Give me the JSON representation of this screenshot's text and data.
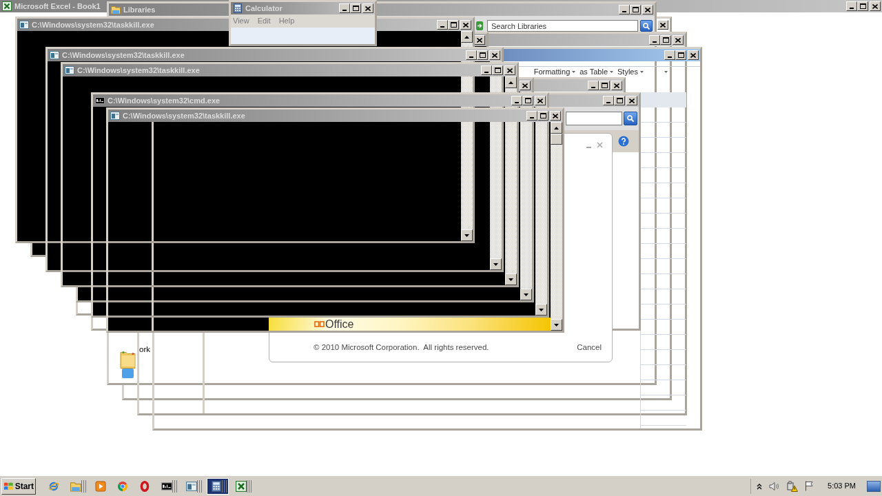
{
  "windows": [
    {
      "kind": "app",
      "title": "Microsoft Excel - Book1",
      "active": false,
      "controls": [
        {
          "kind": "minimize"
        },
        {
          "kind": "maximize"
        },
        {
          "kind": "close"
        }
      ]
    },
    {
      "kind": "explorer",
      "controls": [
        {
          "kind": "close"
        }
      ]
    },
    {
      "kind": "explorer",
      "title": "Libraries",
      "active": false,
      "controls": [
        {
          "kind": "minimize"
        },
        {
          "kind": "maximize"
        },
        {
          "kind": "close"
        }
      ],
      "search_box": true,
      "search_placeholder": "Search Libraries",
      "nav_items": [
        {
          "label": "ork"
        }
      ]
    },
    {
      "kind": "explorer",
      "active": false,
      "controls": [
        {
          "kind": "minimize"
        },
        {
          "kind": "maximize"
        },
        {
          "kind": "close"
        }
      ]
    },
    {
      "kind": "spreadsheet",
      "active": true,
      "controls": [
        {
          "kind": "minimize"
        },
        {
          "kind": "maximize"
        },
        {
          "kind": "close"
        }
      ],
      "ribbon": [
        {
          "kind": "dropdown",
          "label": "Formatting"
        },
        {
          "kind": "dropdown",
          "label": "as Table"
        },
        {
          "kind": "dropdown",
          "label": "Styles"
        },
        {
          "kind": "caret"
        }
      ]
    },
    {
      "kind": "explorer",
      "active": false,
      "controls": [
        {
          "kind": "minimize"
        },
        {
          "kind": "maximize"
        },
        {
          "kind": "close"
        }
      ]
    },
    {
      "kind": "explorer",
      "active": false,
      "controls": [
        {
          "kind": "minimize"
        },
        {
          "kind": "maximize"
        },
        {
          "kind": "close"
        }
      ],
      "search_box": true,
      "help_button": true
    },
    {
      "kind": "splash",
      "controls": [
        {
          "kind": "minimize"
        },
        {
          "kind": "close"
        }
      ],
      "logo_text": "Office",
      "copyright": "© 2010 Microsoft Corporation.  All rights reserved.",
      "cancel": "Cancel"
    },
    {
      "kind": "console",
      "controls": [
        {
          "kind": "close"
        }
      ]
    },
    {
      "kind": "console",
      "title": "C:\\Windows\\system32\\taskkill.exe",
      "active": false,
      "controls": [
        {
          "kind": "minimize"
        },
        {
          "kind": "maximize"
        },
        {
          "kind": "close"
        }
      ]
    },
    {
      "kind": "console",
      "title": "C:\\Windows\\system32\\taskkill.exe",
      "active": false,
      "controls": [
        {
          "kind": "minimize"
        },
        {
          "kind": "maximize"
        },
        {
          "kind": "close"
        }
      ]
    },
    {
      "kind": "console",
      "controls": [
        {
          "kind": "close"
        }
      ]
    },
    {
      "kind": "console",
      "title": "C:\\Windows\\system32\\taskkill.exe",
      "active": false,
      "controls": [
        {
          "kind": "minimize"
        },
        {
          "kind": "maximize"
        },
        {
          "kind": "close"
        }
      ]
    },
    {
      "kind": "console",
      "title": "C:\\Windows\\system32\\cmd.exe",
      "active": false,
      "controls": [
        {
          "kind": "minimize"
        },
        {
          "kind": "maximize"
        },
        {
          "kind": "close"
        }
      ]
    },
    {
      "kind": "console",
      "title": "C:\\Windows\\system32\\taskkill.exe",
      "active": false,
      "controls": [
        {
          "kind": "minimize"
        },
        {
          "kind": "maximize"
        },
        {
          "kind": "close"
        }
      ]
    },
    {
      "kind": "calculator",
      "title": "Calculator",
      "active": false,
      "controls": [
        {
          "kind": "minimize"
        },
        {
          "kind": "maximize"
        },
        {
          "kind": "close"
        }
      ],
      "menu": [
        "View",
        "Edit",
        "Help"
      ]
    }
  ],
  "taskbar": {
    "start": "Start",
    "items": [
      {
        "open": false,
        "selected": false
      },
      {
        "open": true,
        "selected": false
      },
      {
        "open": false,
        "selected": false
      },
      {
        "open": false,
        "selected": false
      },
      {
        "open": false,
        "selected": false
      },
      {
        "open": true,
        "selected": false
      },
      {
        "open": true,
        "selected": false
      },
      {
        "open": true,
        "selected": true
      },
      {
        "open": true,
        "selected": false
      }
    ],
    "clock": "5:03 PM"
  }
}
